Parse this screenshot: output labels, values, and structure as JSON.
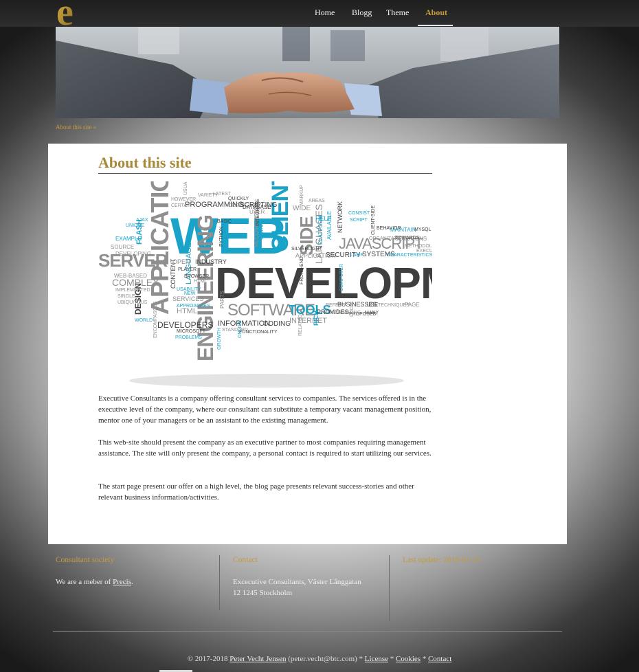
{
  "brand": {
    "logo_letter": "e",
    "accent_color": "#c49a3c"
  },
  "nav": {
    "items": [
      {
        "label": "Home"
      },
      {
        "label": "Blogg"
      },
      {
        "label": "Theme"
      },
      {
        "label": "About"
      }
    ],
    "active": "About"
  },
  "breadcrumb": "About this site »",
  "page": {
    "title": "About this site",
    "paragraphs": [
      "Executive Consultants is a company offering consultant services to companies. The services offered is in the executive level of the company, where our consultant can substitute a temporary vacant management position, mentor one of your managers or be an assistant to the existing management.",
      "This web-site should present the company as an executive partner to most companies requiring management assistance. The site will only present the company, a personal contact is required to start utilizing our services.",
      "The start page present our offer on a high level, the blog page presents relevant success-stories and other relevant business information/activities."
    ]
  },
  "wordcloud": {
    "words": [
      "WEB",
      "DEVELOPMENT",
      "APPLICATIONS",
      "CLIENT",
      "SIDE",
      "ENGINEERING",
      "SERVER",
      "JAVASCRIPT",
      "SOFTWARE",
      "TOOLS",
      "LANGUAGES",
      "COMPLEX",
      "DESIGN",
      "HTML",
      "DEVELOPERS",
      "INFORMATION",
      "CODING",
      "INTERNET",
      "SECURITY",
      "SYSTEMS",
      "PROGRAMMING",
      "SCRIPTING",
      "LANGUAGE",
      "INDUSTRY",
      "FLASH",
      "WIDE",
      "APPLICATION",
      "PROVIDES",
      "BUSINESSES",
      "SERVICES",
      "CONTENT",
      "OPEN",
      "WEB-BASED",
      "SOURCE",
      "USE",
      "PAGE",
      "HELP",
      "NETWORK",
      "AVAILABLE",
      "PLATFORM",
      "RICH",
      "SOLUTIONS",
      "EXAMPLE",
      "DEVELOPING",
      "BASIC",
      "USER",
      "DATABASE",
      "REQUIREMENTS",
      "USING",
      "AJAX",
      "UNIQUE",
      "MAINTAIN",
      "TOWARDS",
      "METHODOLOGIES",
      "CHARACTERISTICS",
      "EXECUTED",
      "SCRIPT",
      "CONSIST",
      "LAMP",
      "PROBLEMS",
      "NEW",
      "PARTS",
      "FUNCTIONALITY",
      "STANDARD",
      "GROWTH",
      "COMPUTER",
      "MYSQL",
      "BEHAVIOR",
      "PROPOSED",
      "MANY",
      "REFERS",
      "TECHNIQUES",
      "SILVERLIGHT",
      "MARKUP",
      "AREAS",
      "HTML",
      "QUICKLY",
      "CREATE",
      "VARIETY",
      "LATEST",
      "HOWEVER",
      "CERTAIN",
      "USABILITY",
      "APPROACHES",
      "MICROSOFT",
      "IMPLEMENTED",
      "SINGLE",
      "UBIQUITOUS",
      "WORLD",
      "ENCOMPASSES",
      "RELATED",
      "CONTRIBUTING",
      "LOCAL",
      "ONLINE",
      "PYTHON",
      "ORGANIZATIONS",
      "CLIENT-SIDE",
      "FRONT-END",
      "INTEGRATE",
      "PLAYER",
      "BROWSER",
      "USUALLY"
    ]
  },
  "footer": {
    "col1": {
      "title": "Consultant society",
      "text_prefix": "We are a meber of ",
      "link": "Precis",
      "text_suffix": "."
    },
    "col2": {
      "title": "Contact",
      "line1": "Excecutive Consultants, Väster Långgatan",
      "line2": "12 1245 Stockholm"
    },
    "col3": {
      "title": "Last update: 2018-01-13"
    }
  },
  "copyright": {
    "prefix": "© 2017-2018 ",
    "author": "Peter Vecht Jensen",
    "email": " (peter.vecht@btc.com) * ",
    "license": "License",
    "sep1": " * ",
    "cookies": "Cookies",
    "sep2": " * ",
    "contact": "Contact"
  }
}
